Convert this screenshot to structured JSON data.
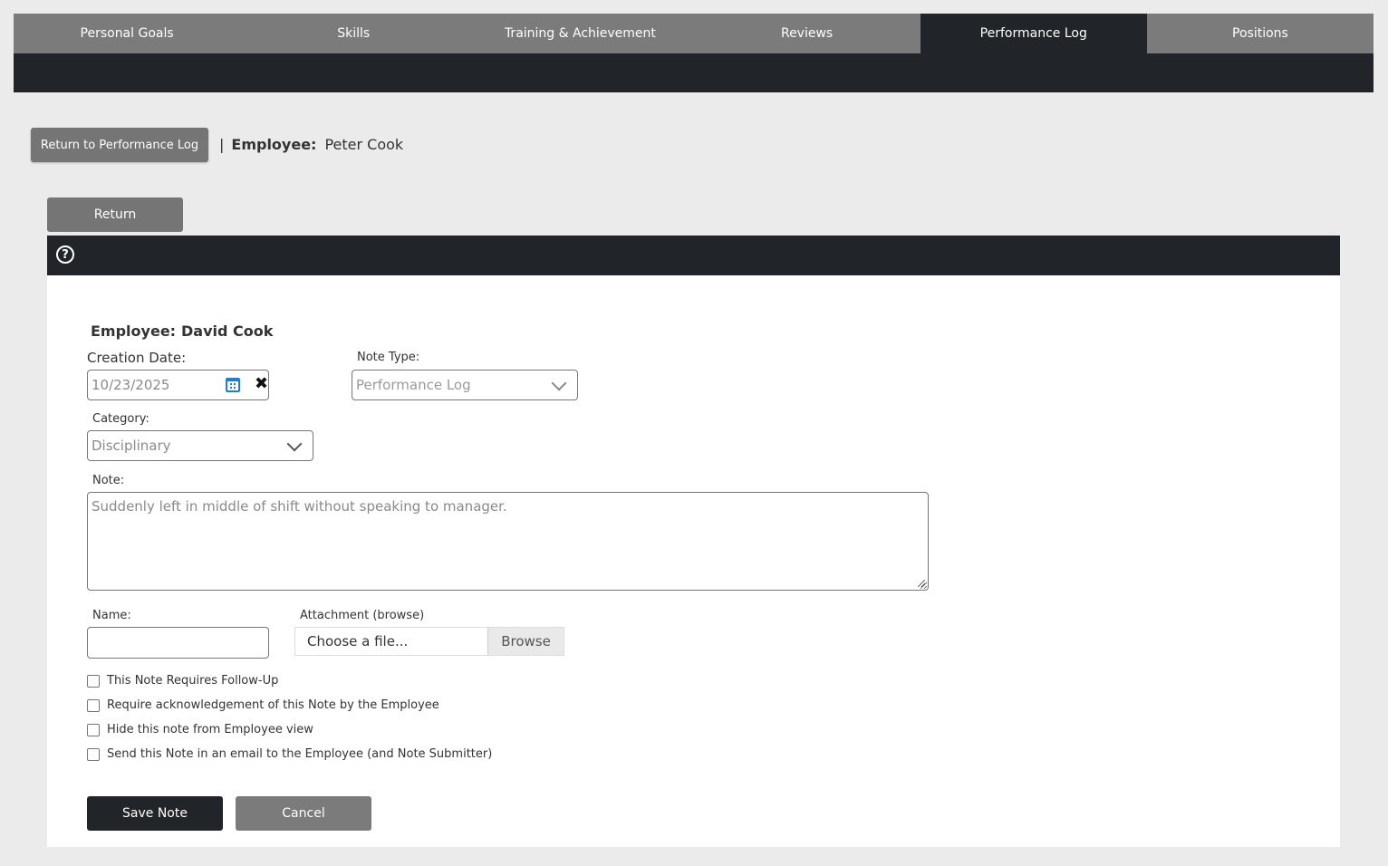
{
  "tabs": [
    {
      "label": "Personal Goals",
      "active": false
    },
    {
      "label": "Skills",
      "active": false
    },
    {
      "label": "Training & Achievement",
      "active": false
    },
    {
      "label": "Reviews",
      "active": false
    },
    {
      "label": "Performance Log",
      "active": true
    },
    {
      "label": "Positions",
      "active": false
    }
  ],
  "breadcrumb": {
    "return_label": "Return to Performance Log",
    "separator": "|",
    "employee_label": "Employee:",
    "employee_name": "Peter Cook"
  },
  "return_button": "Return",
  "help_icon": "question-circle-icon",
  "form": {
    "employee_label": "Employee:",
    "employee_name": "David Cook",
    "creation_date_label": "Creation Date:",
    "creation_date": "10/23/2025",
    "calendar_icon": "calendar-icon",
    "clear_icon": "close-icon",
    "clear_glyph": "✖",
    "note_type_label": "Note Type:",
    "note_type": "Performance Log",
    "category_label": "Category:",
    "category": "Disciplinary",
    "note_label": "Note:",
    "note": "Suddenly left in middle of shift without speaking to manager.",
    "name_label": "Name:",
    "name_value": "",
    "attachment_label": "Attachment (browse)",
    "attachment_placeholder": "Choose a file...",
    "browse_label": "Browse",
    "checkboxes": [
      {
        "label": "This Note Requires Follow-Up",
        "checked": false
      },
      {
        "label": "Require acknowledgement of this Note by the Employee",
        "checked": false
      },
      {
        "label": "Hide this note from Employee view",
        "checked": false
      },
      {
        "label": "Send this Note in an email to the Employee (and Note Submitter)",
        "checked": false
      }
    ],
    "save_label": "Save Note",
    "cancel_label": "Cancel"
  },
  "colors": {
    "dark": "#212429",
    "tab_gray": "#7b7b7b",
    "accent_blue": "#1e7fd6",
    "background": "#ebebeb"
  }
}
